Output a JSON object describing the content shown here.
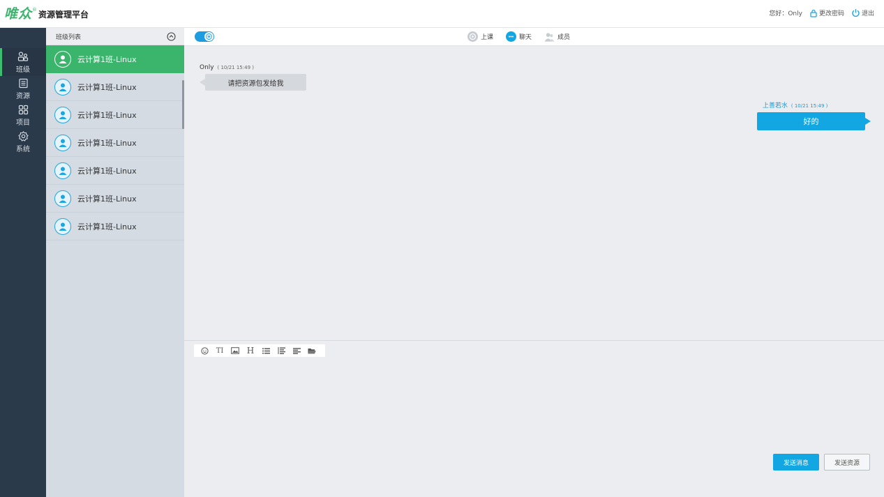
{
  "header": {
    "logo_mark": "唯众",
    "logo_reg": "®",
    "app_title": "资源管理平台",
    "greeting": "您好：Only",
    "change_password": "更改密码",
    "logout": "退出"
  },
  "sidebar": {
    "items": [
      {
        "label": "班级",
        "icon": "users-icon",
        "active": true
      },
      {
        "label": "资源",
        "icon": "document-icon",
        "active": false
      },
      {
        "label": "项目",
        "icon": "grid-icon",
        "active": false
      },
      {
        "label": "系统",
        "icon": "gear-icon",
        "active": false
      }
    ]
  },
  "class_panel": {
    "title": "班级列表",
    "classes": [
      {
        "name": "云计算1班-Linux",
        "active": true
      },
      {
        "name": "云计算1班-Linux",
        "active": false
      },
      {
        "name": "云计算1班-Linux",
        "active": false
      },
      {
        "name": "云计算1班-Linux",
        "active": false
      },
      {
        "name": "云计算1班-Linux",
        "active": false
      },
      {
        "name": "云计算1班-Linux",
        "active": false
      },
      {
        "name": "云计算1班-Linux",
        "active": false
      }
    ]
  },
  "topbar": {
    "modes": [
      {
        "label": "上课",
        "icon": "lesson-icon"
      },
      {
        "label": "聊天",
        "icon": "chat-icon",
        "active": true
      },
      {
        "label": "成员",
        "icon": "members-icon"
      }
    ]
  },
  "chat": {
    "messages": [
      {
        "sender": "Only",
        "time": "( 10/21 15:49 )",
        "text": "请把资源包发给我",
        "side": "left"
      },
      {
        "sender": "上善若水",
        "time": "( 10/21 15:49 )",
        "text": "好的",
        "side": "right"
      }
    ]
  },
  "composer": {
    "tools": [
      "emoji-icon",
      "font-size-icon",
      "image-icon",
      "heading-icon",
      "bullet-list-icon",
      "numbered-list-icon",
      "align-icon",
      "folder-icon"
    ],
    "heading_glyph": "H",
    "font_glyph": "TI",
    "send_message": "发送消息",
    "send_resource": "发送资源"
  },
  "colors": {
    "accent_green": "#3bb56c",
    "accent_blue": "#12a6e3",
    "sidebar_bg": "#2b3a4a"
  }
}
